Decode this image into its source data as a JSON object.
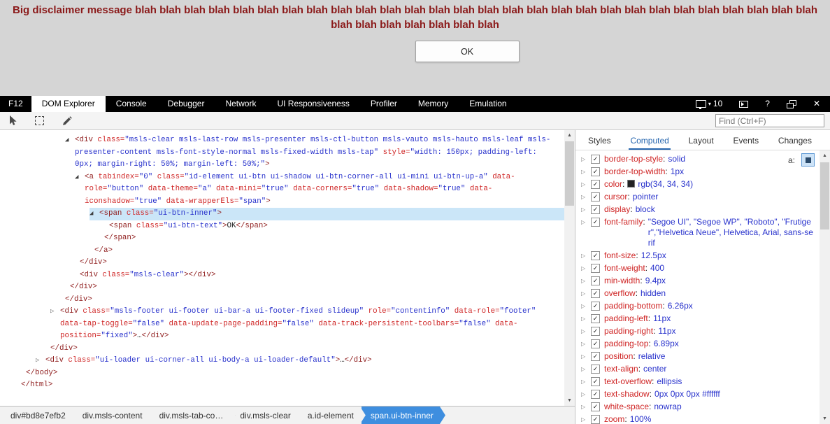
{
  "page": {
    "disclaimer_line1": "Big disclaimer message blah blah blah blah blah blah blah blah blah blah blah blah blah blah blah blah blah blah blah blah blah blah blah blah blah blah blah blah",
    "disclaimer_line2": "blah blah blah blah blah blah blah",
    "ok_button_label": "OK"
  },
  "colors": {
    "disclaimer_text": "#8b1a1a",
    "code_tag": "#8f1d1d",
    "code_attr": "#cf2525",
    "code_val": "#2832cc",
    "sel_line": "#cbe6f8",
    "crumb_sel": "#3e8edf"
  },
  "devtools": {
    "logo": "F12",
    "tabs": [
      {
        "label": "DOM Explorer",
        "active": true
      },
      {
        "label": "Console",
        "active": false
      },
      {
        "label": "Debugger",
        "active": false
      },
      {
        "label": "Network",
        "active": false
      },
      {
        "label": "UI Responsiveness",
        "active": false
      },
      {
        "label": "Profiler",
        "active": false
      },
      {
        "label": "Memory",
        "active": false
      },
      {
        "label": "Emulation",
        "active": false
      }
    ],
    "window_controls": {
      "document_mode": "10",
      "help": "?",
      "close": "✕"
    },
    "toolbar": {
      "find_placeholder": "Find (Ctrl+F)"
    }
  },
  "dom_tree": {
    "lines": [
      {
        "i": 9,
        "a": "exp",
        "st": "d",
        "hl": false,
        "c": "<div class=\"msls-clear msls-last-row msls-presenter msls-ctl-button msls-vauto msls-hauto msls-leaf msls-"
      },
      {
        "i": 11,
        "a": null,
        "st": "v",
        "hl": false,
        "c": "presenter-content msls-font-style-normal msls-fixed-width msls-tap\" style=\"width: 150px; padding-left:"
      },
      {
        "i": 11,
        "a": null,
        "st": "v",
        "hl": false,
        "c": "0px; margin-right: 50%; margin-left: 50%;\">"
      },
      {
        "i": 11,
        "a": "exp",
        "st": "d",
        "hl": false,
        "c": "<a tabindex=\"0\" class=\"id-element ui-btn ui-shadow ui-btn-corner-all ui-mini ui-btn-up-a\" data-"
      },
      {
        "i": 13,
        "a": null,
        "st": "t",
        "hl": false,
        "c": "role=\"button\" data-theme=\"a\" data-mini=\"true\" data-corners=\"true\" data-shadow=\"true\" data-"
      },
      {
        "i": 13,
        "a": null,
        "st": "t",
        "hl": false,
        "c": "iconshadow=\"true\" data-wrapperEls=\"span\">"
      },
      {
        "i": 14,
        "a": "exp",
        "st": "d",
        "hl": true,
        "c": "<span class=\"ui-btn-inner\">"
      },
      {
        "i": 18,
        "a": null,
        "st": "d",
        "hl": false,
        "c": "<span class=\"ui-btn-text\">OK</span>"
      },
      {
        "i": 17,
        "a": null,
        "st": "d",
        "hl": false,
        "c": "</span>"
      },
      {
        "i": 15,
        "a": null,
        "st": "d",
        "hl": false,
        "c": "</a>"
      },
      {
        "i": 12,
        "a": null,
        "st": "d",
        "hl": false,
        "c": "</div>"
      },
      {
        "i": 12,
        "a": null,
        "st": "d",
        "hl": false,
        "c": "<div class=\"msls-clear\"></div>"
      },
      {
        "i": 10,
        "a": null,
        "st": "d",
        "hl": false,
        "c": "</div>"
      },
      {
        "i": 9,
        "a": null,
        "st": "d",
        "hl": false,
        "c": "</div>"
      },
      {
        "i": 6,
        "a": "col",
        "st": "d",
        "hl": false,
        "c": "<div class=\"msls-footer ui-footer ui-bar-a ui-footer-fixed slideup\" role=\"contentinfo\" data-role=\"footer\""
      },
      {
        "i": 8,
        "a": null,
        "st": "t",
        "hl": false,
        "c": "data-tap-toggle=\"false\" data-update-page-padding=\"false\" data-track-persistent-toolbars=\"false\" data-"
      },
      {
        "i": 8,
        "a": null,
        "st": "t",
        "hl": false,
        "c": "position=\"fixed\">…</div>"
      },
      {
        "i": 6,
        "a": null,
        "st": "d",
        "hl": false,
        "c": "</div>"
      },
      {
        "i": 3,
        "a": "col",
        "st": "d",
        "hl": false,
        "c": "<div class=\"ui-loader ui-corner-all ui-body-a ui-loader-default\">…</div>"
      },
      {
        "i": 1,
        "a": null,
        "st": "d",
        "hl": false,
        "c": "</body>"
      },
      {
        "i": 0,
        "a": null,
        "st": "d",
        "hl": false,
        "c": "</html>"
      }
    ]
  },
  "styles_panel": {
    "tabs": [
      "Styles",
      "Computed",
      "Layout",
      "Events",
      "Changes"
    ],
    "active_tab": "Computed",
    "pseudo_toggle_label": "a:",
    "properties": [
      {
        "name": "border-top-style",
        "value": "solid"
      },
      {
        "name": "border-top-width",
        "value": "1px"
      },
      {
        "name": "color",
        "value": "rgb(34, 34, 34)",
        "swatch": "#222222"
      },
      {
        "name": "cursor",
        "value": "pointer"
      },
      {
        "name": "display",
        "value": "block"
      },
      {
        "name": "font-family",
        "value": "\"Segoe UI\", \"Segoe WP\", \"Roboto\", \"Frutiger\",\"Helvetica Neue\", Helvetica, Arial, sans-serif"
      },
      {
        "name": "font-size",
        "value": "12.5px"
      },
      {
        "name": "font-weight",
        "value": "400"
      },
      {
        "name": "min-width",
        "value": "9.4px"
      },
      {
        "name": "overflow",
        "value": "hidden"
      },
      {
        "name": "padding-bottom",
        "value": "6.26px"
      },
      {
        "name": "padding-left",
        "value": "11px"
      },
      {
        "name": "padding-right",
        "value": "11px"
      },
      {
        "name": "padding-top",
        "value": "6.89px"
      },
      {
        "name": "position",
        "value": "relative"
      },
      {
        "name": "text-align",
        "value": "center"
      },
      {
        "name": "text-overflow",
        "value": "ellipsis"
      },
      {
        "name": "text-shadow",
        "value": "0px 0px 0px #ffffff"
      },
      {
        "name": "white-space",
        "value": "nowrap"
      },
      {
        "name": "zoom",
        "value": "100%"
      }
    ]
  },
  "breadcrumbs": [
    {
      "label": "div#bd8e7efb2",
      "selected": false
    },
    {
      "label": "div.msls-content",
      "selected": false
    },
    {
      "label": "div.msls-tab-co…",
      "selected": false
    },
    {
      "label": "div.msls-clear",
      "selected": false
    },
    {
      "label": "a.id-element",
      "selected": false
    },
    {
      "label": "span.ui-btn-inner",
      "selected": true
    }
  ]
}
